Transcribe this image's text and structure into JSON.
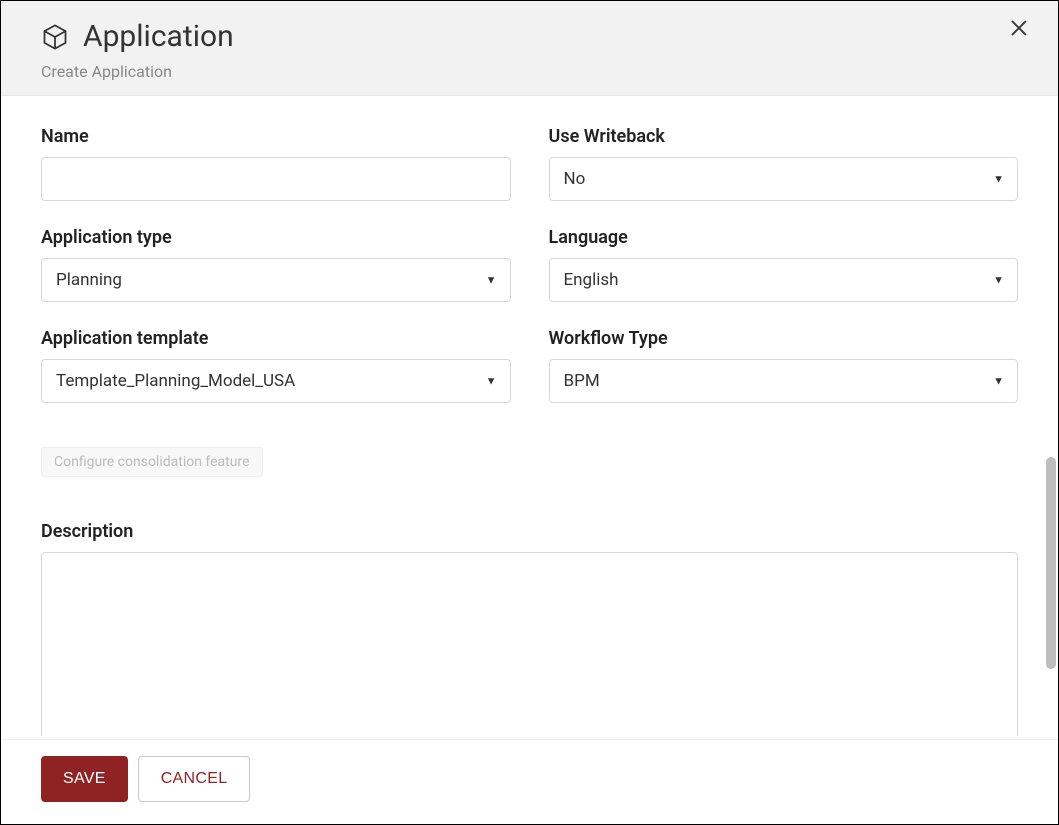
{
  "header": {
    "title": "Application",
    "subtitle": "Create Application"
  },
  "form": {
    "name": {
      "label": "Name",
      "value": ""
    },
    "writeback": {
      "label": "Use Writeback",
      "value": "No"
    },
    "appType": {
      "label": "Application type",
      "value": "Planning"
    },
    "language": {
      "label": "Language",
      "value": "English"
    },
    "template": {
      "label": "Application template",
      "value": "Template_Planning_Model_USA"
    },
    "workflow": {
      "label": "Workflow Type",
      "value": "BPM"
    },
    "configure": {
      "label": "Configure consolidation feature"
    },
    "description": {
      "label": "Description",
      "value": ""
    }
  },
  "footer": {
    "save": "SAVE",
    "cancel": "CANCEL"
  }
}
